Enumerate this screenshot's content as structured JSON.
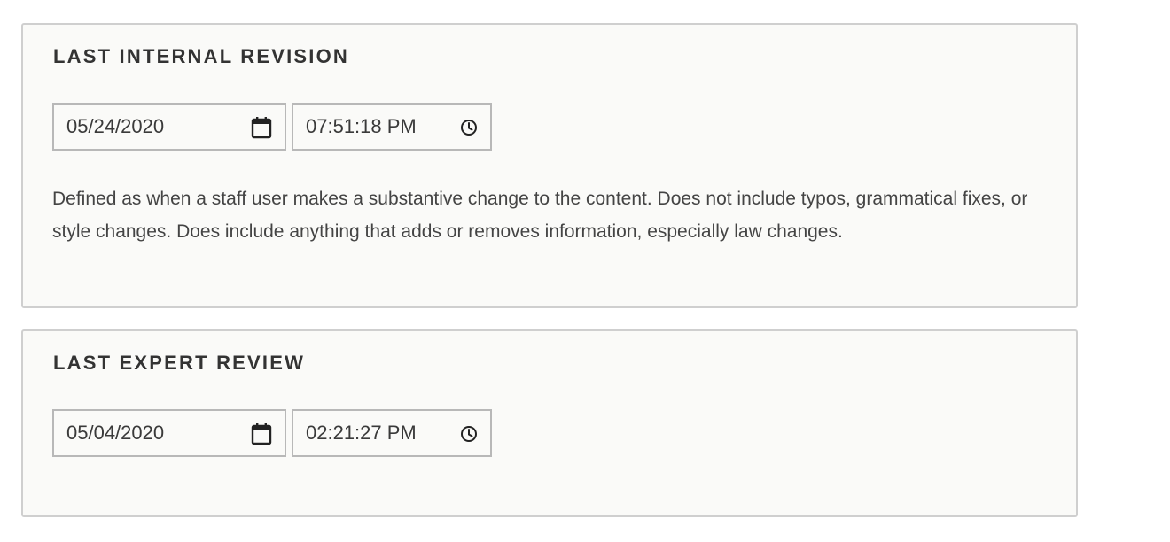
{
  "sections": [
    {
      "title": "LAST INTERNAL REVISION",
      "date_value": "05/24/2020",
      "time_value": "07:51:18 PM",
      "date_icon": "calendar-icon",
      "time_icon": "clock-icon",
      "description": "Defined as when a staff user makes a substantive change to the content. Does not include typos, grammatical fixes, or style changes. Does include anything that adds or removes information, especially law changes."
    },
    {
      "title": "LAST EXPERT REVIEW",
      "date_value": "05/04/2020",
      "time_value": "02:21:27 PM",
      "date_icon": "calendar-icon",
      "time_icon": "clock-icon"
    }
  ]
}
